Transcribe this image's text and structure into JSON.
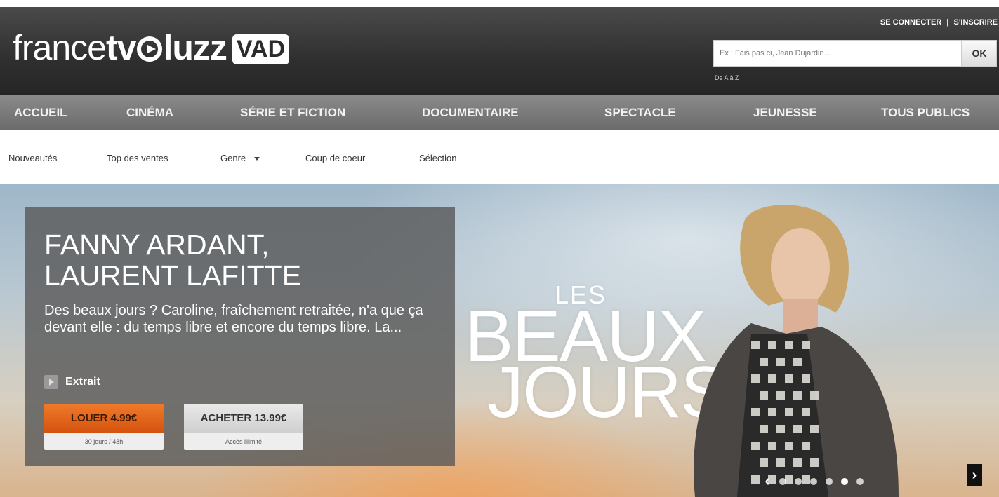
{
  "header": {
    "logo": {
      "part1": "france",
      "part2": "tv",
      "part3": "luzz",
      "badge": "VAD"
    },
    "account": {
      "login": "SE CONNECTER",
      "separator": "|",
      "register": "S'INSCRIRE"
    },
    "search": {
      "placeholder": "Ex : Fais pas ci, Jean Dujardin...",
      "button": "OK"
    },
    "az_link": "De A à Z"
  },
  "main_nav": [
    "ACCUEIL",
    "CINÉMA",
    "SÉRIE ET FICTION",
    "DOCUMENTAIRE",
    "SPECTACLE",
    "JEUNESSE",
    "TOUS PUBLICS"
  ],
  "sub_nav": [
    "Nouveautés",
    "Top des ventes",
    "Genre",
    "Coup de coeur",
    "Sélection"
  ],
  "hero": {
    "title_line1": "FANNY ARDANT,",
    "title_line2": "LAURENT LAFITTE",
    "description": "Des beaux jours ? Caroline, fraîchement retraitée, n'a que ça devant elle : du temps libre et encore du temps libre. La...",
    "extrait_label": "Extrait",
    "rent": {
      "label": "LOUER 4.99€",
      "sub": "30 jours / 48h"
    },
    "buy": {
      "label": "ACHETER 13.99€",
      "sub": "Accès illimité"
    },
    "poster_text": {
      "line1": "LES",
      "line2": "BEAUX",
      "line3": "JOURS"
    },
    "carousel": {
      "count": 6,
      "active": 5,
      "prev": "‹",
      "next": "›"
    }
  }
}
